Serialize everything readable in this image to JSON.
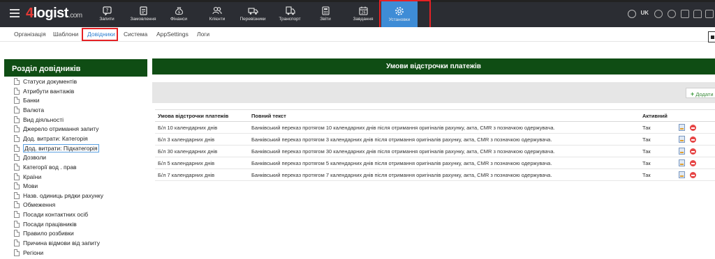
{
  "app": {
    "logo_prefix": "4",
    "logo_main": "logist",
    "logo_suffix": ".com"
  },
  "topnav": {
    "items": [
      {
        "label": "Запити",
        "icon": "chat-question-icon"
      },
      {
        "label": "Замовлення",
        "icon": "order-list-icon"
      },
      {
        "label": "Фінанси",
        "icon": "money-bag-icon"
      },
      {
        "label": "Клієнти",
        "icon": "users-icon"
      },
      {
        "label": "Перевізники",
        "icon": "truck-icon"
      },
      {
        "label": "Транспорт",
        "icon": "vehicle-icon"
      },
      {
        "label": "Звіти",
        "icon": "calculator-icon"
      },
      {
        "label": "Завдання",
        "icon": "calendar-icon"
      },
      {
        "label": "Установки",
        "icon": "gear-icon",
        "active": true
      }
    ],
    "language": "UK"
  },
  "subnav": {
    "tabs": [
      "Організація",
      "Шаблони",
      "Довідники",
      "Система",
      "AppSettings",
      "Логи"
    ],
    "active": "Довідники"
  },
  "sidebar": {
    "title": "Розділ довідників",
    "items": [
      "Статуси документів",
      "Атрибути вантажів",
      "Банки",
      "Валюта",
      "Вид діяльності",
      "Джерело отримання запиту",
      "Дод. витрати: Категорія",
      "Дод. витрати: Підкатегорія",
      "Дозволи",
      "Категорії вод . прав",
      "Країни",
      "Мови",
      "Назв. одиниць рядки рахунку",
      "Обмеження",
      "Посади контактних осіб",
      "Посади працівників",
      "Правило розбивки",
      "Причина відмови від запиту",
      "Регіони"
    ],
    "selected_index": 7
  },
  "main": {
    "title": "Умови відстрочки платежів",
    "add_label": "Додати",
    "columns": [
      "Умова відстрочки платежів",
      "Повний текст",
      "Активний"
    ],
    "rows": [
      [
        "Б/л 10 календарних днів",
        "Банківський переказ протягом 10 календарних днів після отримання оригіналів рахунку, акта, CMR з позначкою одержувача.",
        "Так"
      ],
      [
        "Б/л 3 календарних днів",
        "Банківський переказ протягом 3 календарних днів після отримання оригіналів рахунку, акта, CMR з позначкою одержувача.",
        "Так"
      ],
      [
        "Б/л 30 календарних днів",
        "Банківський переказ протягом 30 календарних днів після отримання оригіналів рахунку, акта, CMR з позначкою одержувача.",
        "Так"
      ],
      [
        "Б/л 5 календарних днів",
        "Банківський переказ протягом 5 календарних днів після отримання оригіналів рахунку, акта, CMR з позначкою одержувача.",
        "Так"
      ],
      [
        "Б/л 7 календарних днів",
        "Банківський переказ протягом 7 календарних днів після отримання оригіналів рахунку, акта, CMR з позначкою одержувача.",
        "Так"
      ]
    ]
  },
  "colors": {
    "nav_bg": "#2b2d33",
    "active_tab": "#3e8cd6",
    "header_green": "#0f4d14",
    "highlight_red": "#e52125"
  }
}
